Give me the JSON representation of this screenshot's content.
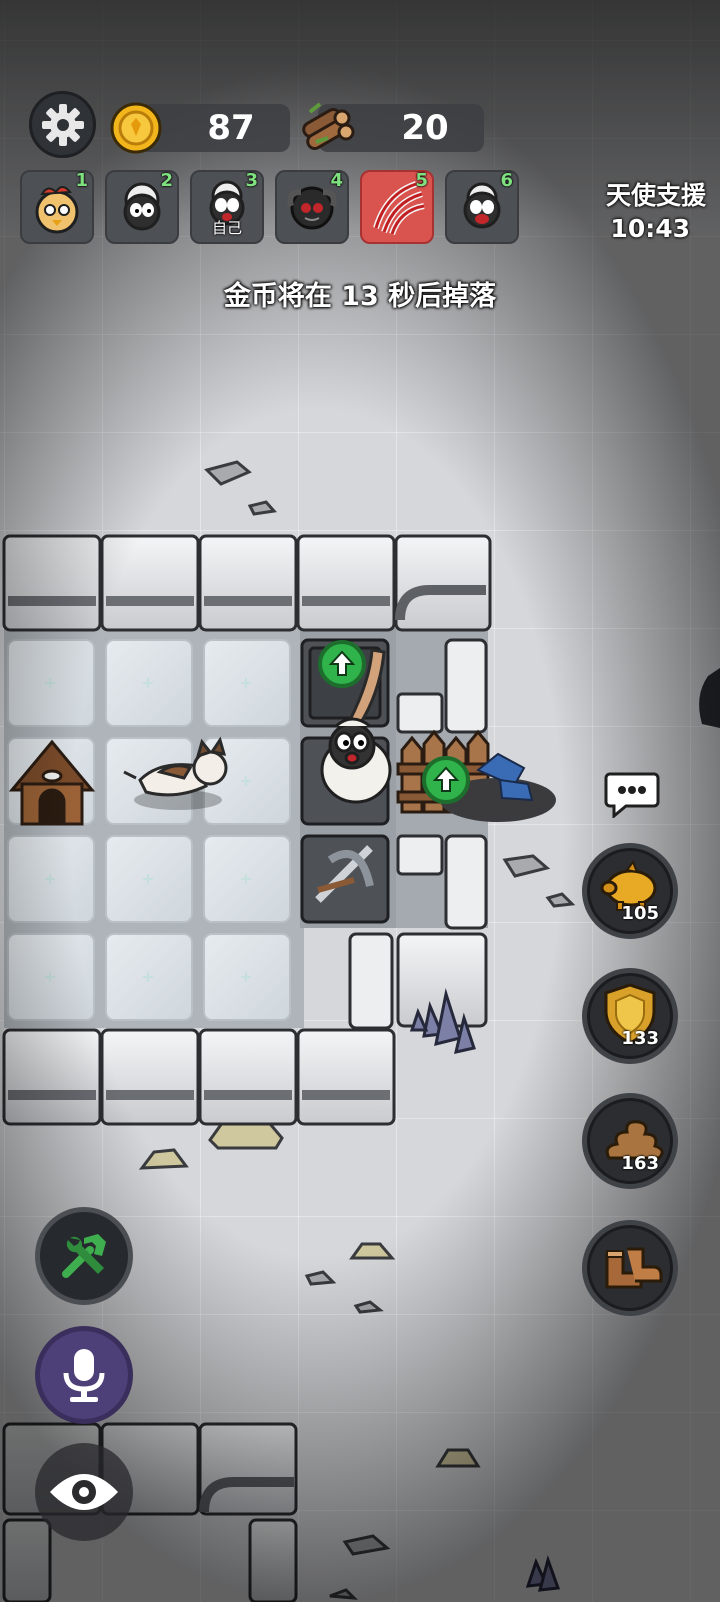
{
  "hud": {
    "coins": "87",
    "wood": "20",
    "angel_support_label": "天使支援",
    "angel_support_timer": "10:43",
    "coin_drop_message": "金币将在 13 秒后掉落"
  },
  "players": [
    {
      "number": "1",
      "avatar": "chicken-sheep-avatar",
      "self_label": ""
    },
    {
      "number": "2",
      "avatar": "sheep-avatar",
      "self_label": ""
    },
    {
      "number": "3",
      "avatar": "sheep-red-mouth-avatar",
      "self_label": "自己"
    },
    {
      "number": "4",
      "avatar": "black-ram-avatar",
      "self_label": ""
    },
    {
      "number": "5",
      "avatar": "claw-avatar",
      "self_label": "",
      "active": true
    },
    {
      "number": "6",
      "avatar": "sheep-red-mouth-avatar",
      "self_label": ""
    }
  ],
  "abilities": [
    {
      "name": "piggy-bank-icon",
      "count": "105"
    },
    {
      "name": "shield-icon",
      "count": "133"
    },
    {
      "name": "poop-icon",
      "count": "163"
    },
    {
      "name": "boots-icon",
      "count": ""
    }
  ],
  "colors": {
    "active_slot": "#d9534f",
    "player_number": "#7ee07e",
    "upgrade_arrow": "#2fb34a",
    "mic_button": "#4d3f77"
  }
}
